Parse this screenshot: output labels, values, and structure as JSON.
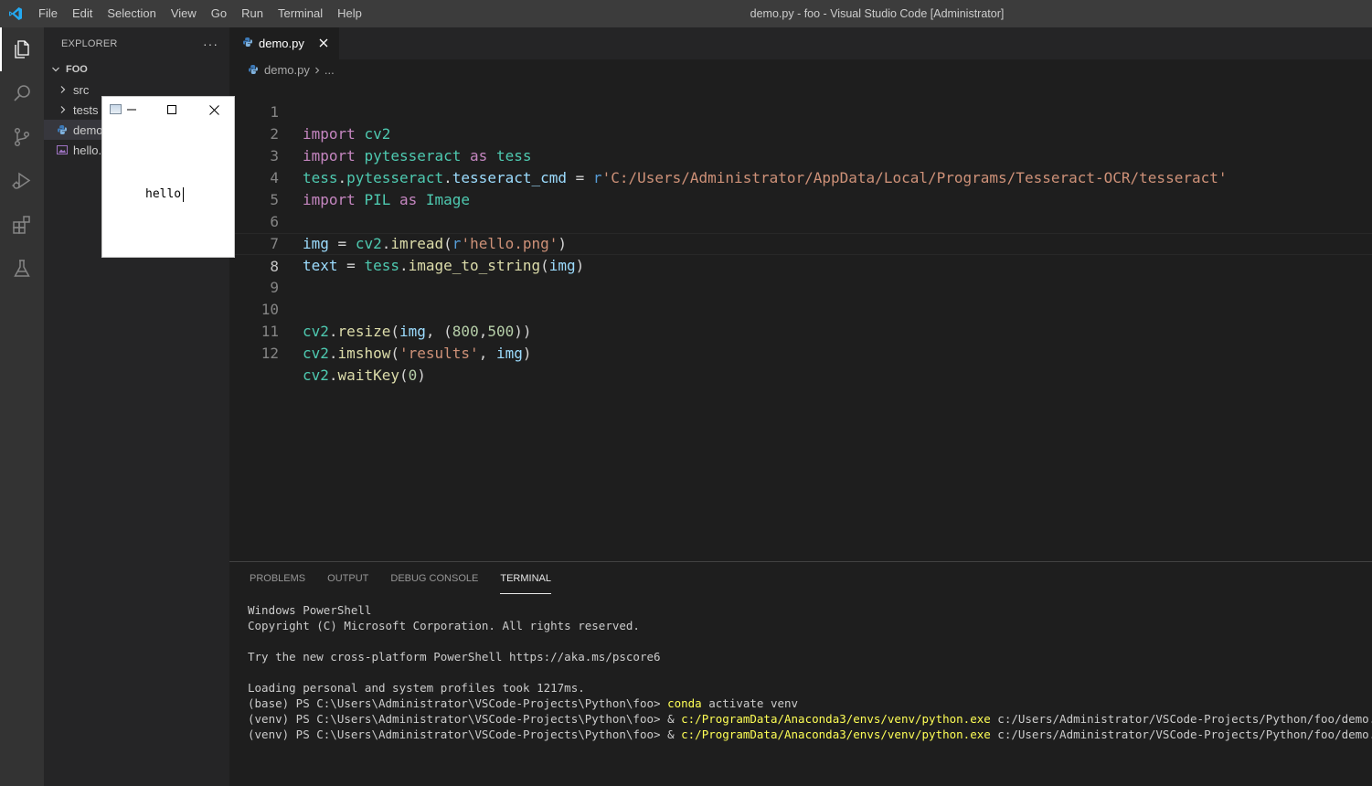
{
  "titlebar": {
    "menu": [
      "File",
      "Edit",
      "Selection",
      "View",
      "Go",
      "Run",
      "Terminal",
      "Help"
    ],
    "window_title": "demo.py - foo - Visual Studio Code [Administrator]"
  },
  "activitybar": {
    "icons": [
      "explorer-icon",
      "search-icon",
      "source-control-icon",
      "run-debug-icon",
      "extensions-icon",
      "testing-icon"
    ]
  },
  "sidebar": {
    "title": "EXPLORER",
    "more": "···",
    "root": "FOO",
    "items": [
      {
        "label": "src",
        "type": "folder"
      },
      {
        "label": "tests",
        "type": "folder"
      },
      {
        "label": "demo.py",
        "type": "python"
      },
      {
        "label": "hello.png",
        "type": "image"
      }
    ]
  },
  "cv_window": {
    "image_text": "hello"
  },
  "editor": {
    "tab": {
      "label": "demo.py"
    },
    "breadcrumb": {
      "file": "demo.py",
      "more": "..."
    },
    "lines": [
      "1",
      "2",
      "3",
      "4",
      "5",
      "6",
      "7",
      "8",
      "9",
      "10",
      "11",
      "12"
    ],
    "code": {
      "l1": {
        "a": "import",
        "b": "cv2"
      },
      "l2": {
        "a": "import",
        "b": "pytesseract",
        "c": "as",
        "d": "tess"
      },
      "l3": {
        "a": "tess",
        "b": ".",
        "c": "pytesseract",
        "d": ".",
        "e": "tesseract_cmd",
        "f": " = ",
        "g": "r",
        "h": "'C:/Users/Administrator/AppData/Local/Programs/Tesseract-OCR/tesseract'"
      },
      "l4": {
        "a": "import",
        "b": "PIL",
        "c": "as",
        "d": "Image"
      },
      "l6": {
        "a": "img",
        "b": " = ",
        "c": "cv2",
        "d": ".",
        "e": "imread",
        "f": "(",
        "g": "r",
        "h": "'hello.png'",
        "i": ")"
      },
      "l7": {
        "a": "text",
        "b": " = ",
        "c": "tess",
        "d": ".",
        "e": "image_to_string",
        "f": "(",
        "g": "img",
        "h": ")"
      },
      "l10": {
        "a": "cv2",
        "b": ".",
        "c": "resize",
        "d": "(",
        "e": "img",
        "f": ", (",
        "g": "800",
        "h": ",",
        "i": "500",
        "j": "))"
      },
      "l11": {
        "a": "cv2",
        "b": ".",
        "c": "imshow",
        "d": "(",
        "e": "'results'",
        "f": ", ",
        "g": "img",
        "h": ")"
      },
      "l12": {
        "a": "cv2",
        "b": ".",
        "c": "waitKey",
        "d": "(",
        "e": "0",
        "f": ")"
      }
    }
  },
  "panel": {
    "tabs": [
      "PROBLEMS",
      "OUTPUT",
      "DEBUG CONSOLE",
      "TERMINAL"
    ],
    "terminal": {
      "l1": "Windows PowerShell",
      "l2": "Copyright (C) Microsoft Corporation. All rights reserved.",
      "l3": "",
      "l4": "Try the new cross-platform PowerShell https://aka.ms/pscore6",
      "l5": "",
      "l6": "Loading personal and system profiles took 1217ms.",
      "l7_prompt": "(base) PS C:\\Users\\Administrator\\VSCode-Projects\\Python\\foo> ",
      "l7_cmd": "conda",
      "l7_rest": " activate venv",
      "l8_prompt": "(venv) PS C:\\Users\\Administrator\\VSCode-Projects\\Python\\foo> & ",
      "l8_exe": "c:/ProgramData/Anaconda3/envs/venv/python.exe",
      "l8_rest": " c:/Users/Administrator/VSCode-Projects/Python/foo/demo.py",
      "l9_prompt": "(venv) PS C:\\Users\\Administrator\\VSCode-Projects\\Python\\foo> & ",
      "l9_exe": "c:/ProgramData/Anaconda3/envs/venv/python.exe",
      "l9_rest": " c:/Users/Administrator/VSCode-Projects/Python/foo/demo.py"
    }
  },
  "colors": {
    "accent": "#007acc",
    "keyword": "#c586c0",
    "string": "#ce9178",
    "variable": "#9cdcfe",
    "function": "#dcdcaa",
    "module": "#4ec9b0"
  }
}
